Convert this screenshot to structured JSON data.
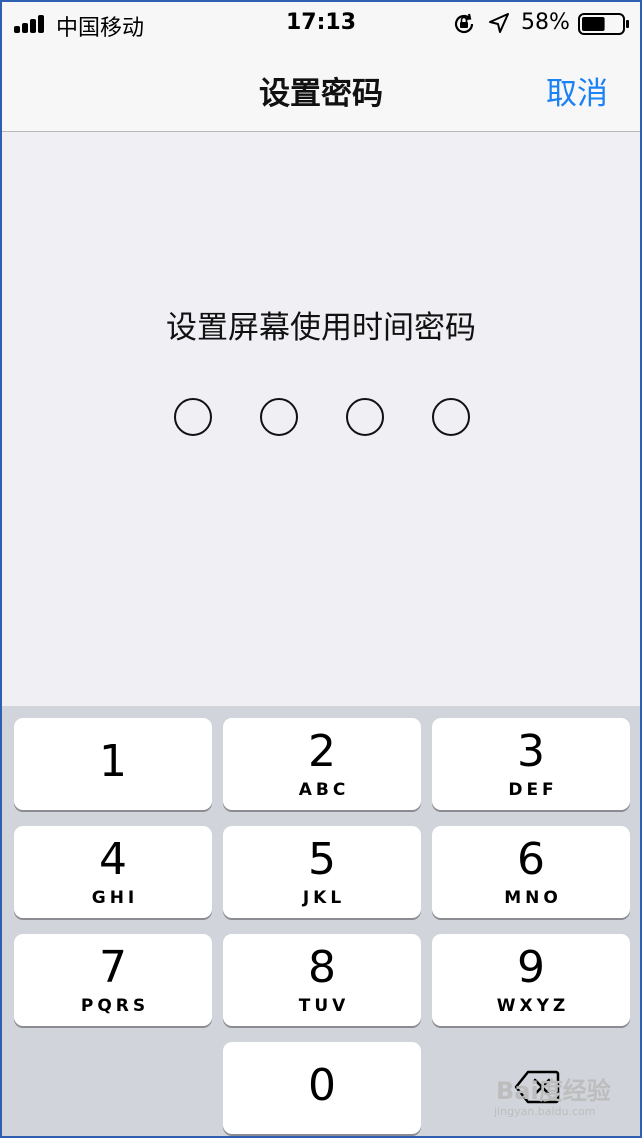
{
  "status_bar": {
    "carrier": "中国移动",
    "time": "17:13",
    "battery_percent": "58%",
    "battery_level": 0.58,
    "signal_bars": 4,
    "icons": [
      "signal-icon",
      "orientation-lock-icon",
      "location-arrow-icon",
      "battery-icon"
    ]
  },
  "nav": {
    "title": "设置密码",
    "cancel_label": "取消",
    "accent_color": "#1a82f5"
  },
  "passcode": {
    "prompt": "设置屏幕使用时间密码",
    "digit_count": 4,
    "filled": 0
  },
  "keypad": {
    "keys": [
      {
        "digit": "1",
        "letters": ""
      },
      {
        "digit": "2",
        "letters": "ABC"
      },
      {
        "digit": "3",
        "letters": "DEF"
      },
      {
        "digit": "4",
        "letters": "GHI"
      },
      {
        "digit": "5",
        "letters": "JKL"
      },
      {
        "digit": "6",
        "letters": "MNO"
      },
      {
        "digit": "7",
        "letters": "PQRS"
      },
      {
        "digit": "8",
        "letters": "TUV"
      },
      {
        "digit": "9",
        "letters": "WXYZ"
      },
      {
        "digit": "0",
        "letters": ""
      }
    ],
    "delete_icon": "backspace-icon"
  },
  "watermark": {
    "main": "Bai度经验",
    "sub": "jingyan.baidu.com"
  }
}
